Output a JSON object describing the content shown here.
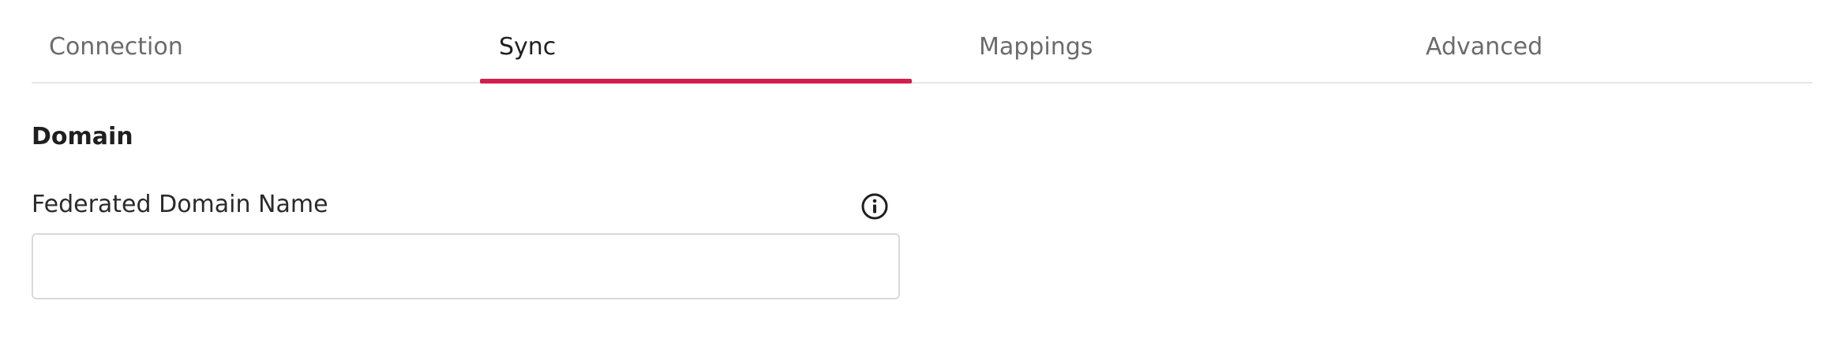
{
  "tabs": {
    "items": [
      {
        "label": "Connection",
        "active": false
      },
      {
        "label": "Sync",
        "active": true
      },
      {
        "label": "Mappings",
        "active": false
      },
      {
        "label": "Advanced",
        "active": false
      }
    ]
  },
  "section": {
    "title": "Domain"
  },
  "federated_domain": {
    "label": "Federated Domain Name",
    "value": "",
    "info_icon": "info-icon"
  },
  "colors": {
    "accent": "#d21e4e",
    "divider": "#e6e6e6",
    "input_border": "#d9d9d9"
  }
}
